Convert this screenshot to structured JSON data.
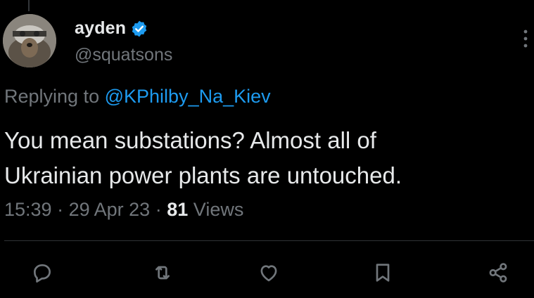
{
  "tweet": {
    "author": {
      "display_name": "ayden",
      "handle": "@squatsons",
      "verified_color": "#1d9bf0"
    },
    "reply_prefix": "Replying to",
    "reply_to": "@KPhilby_Na_Kiev",
    "text_lines": [
      "You mean substations? Almost all of",
      "Ukrainian power plants are untouched."
    ],
    "time": "15:39",
    "date": "29 Apr 23",
    "separator": "·",
    "views_count": "81",
    "views_label": "Views"
  },
  "icons": {
    "avatar": "avatar",
    "verified": "verified-badge-icon",
    "more": "more-vertical-icon",
    "reply": "reply-icon",
    "retweet": "retweet-icon",
    "like": "heart-icon",
    "bookmark": "bookmark-icon",
    "share": "share-icon"
  },
  "colors": {
    "background": "#000000",
    "text_primary": "#e7e9ea",
    "text_secondary": "#71767b",
    "accent": "#1d9bf0",
    "divider": "#2f3336"
  }
}
